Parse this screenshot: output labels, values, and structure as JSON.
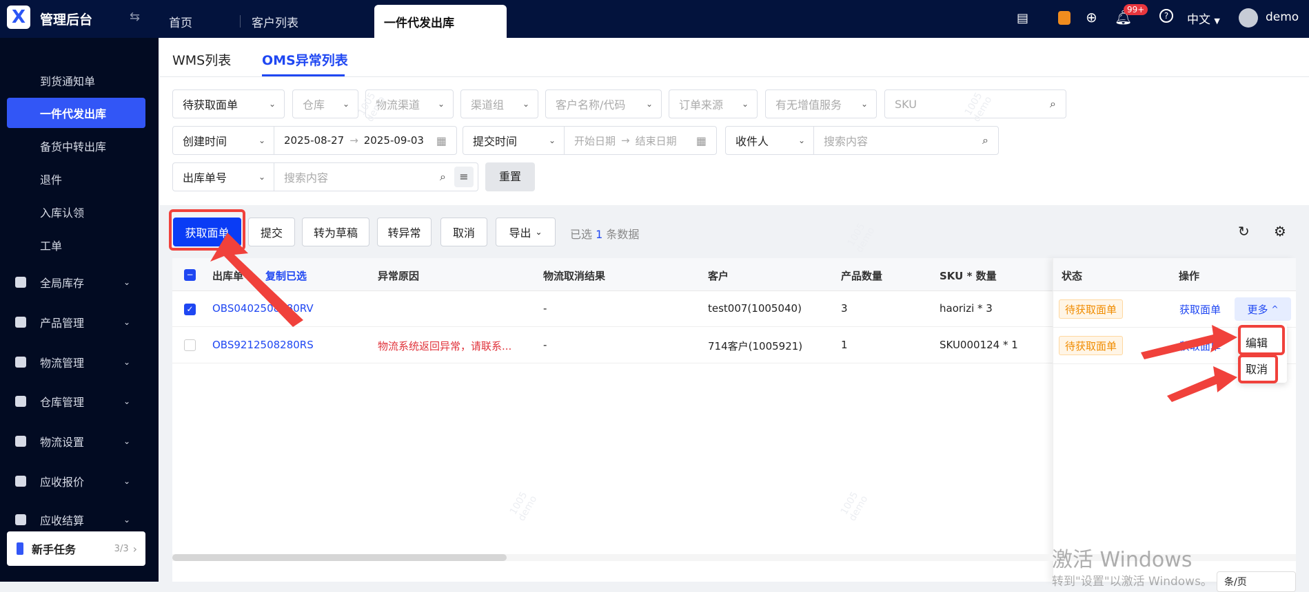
{
  "app": {
    "title": "管理后台"
  },
  "tabs": [
    {
      "label": "首页"
    },
    {
      "label": "客户列表"
    },
    {
      "label": "一件代发出库"
    }
  ],
  "header": {
    "notification_count": "99+",
    "language": "中文",
    "user": "demo"
  },
  "sidebar": {
    "items": [
      {
        "label": "到货通知单"
      },
      {
        "label": "一件代发出库",
        "active": true
      },
      {
        "label": "备货中转出库"
      },
      {
        "label": "退件"
      },
      {
        "label": "入库认领"
      },
      {
        "label": "工单"
      },
      {
        "label": "全局库存",
        "icon": "warehouse-icon"
      },
      {
        "label": "产品管理",
        "icon": "box-icon"
      },
      {
        "label": "物流管理",
        "icon": "truck-icon"
      },
      {
        "label": "仓库管理",
        "icon": "house-icon"
      },
      {
        "label": "物流设置",
        "icon": "logistics-icon"
      },
      {
        "label": "应收报价",
        "icon": "document-icon"
      },
      {
        "label": "应收结算",
        "icon": "settlement-icon"
      }
    ],
    "task_card": {
      "label": "新手任务",
      "progress": "3/3"
    }
  },
  "subtabs": [
    {
      "label": "WMS列表"
    },
    {
      "label": "OMS异常列表",
      "active": true
    }
  ],
  "filters": {
    "status": "待获取面单",
    "warehouse": "仓库",
    "channel": "物流渠道",
    "channel_group": "渠道组",
    "customer": "客户名称/代码",
    "order_source": "订单来源",
    "value_added": "有无增值服务",
    "sku": "SKU",
    "create_time_type": "创建时间",
    "create_start": "2025-08-27",
    "create_end": "2025-09-03",
    "submit_time_type": "提交时间",
    "submit_start": "开始日期",
    "submit_end": "结束日期",
    "receiver_type": "收件人",
    "receiver_placeholder": "搜索内容",
    "order_no_type": "出库单号",
    "order_no_placeholder": "搜索内容",
    "reset": "重置"
  },
  "toolbar": {
    "get_label": "获取面单",
    "submit": "提交",
    "to_draft": "转为草稿",
    "to_exception": "转异常",
    "cancel": "取消",
    "export": "导出",
    "selected_prefix": "已选",
    "selected_count": "1",
    "selected_suffix": "条数据"
  },
  "table": {
    "columns": [
      "出库单号",
      "复制已选",
      "异常原因",
      "物流取消结果",
      "客户",
      "产品数量",
      "SKU * 数量",
      "状态",
      "操作"
    ],
    "rows": [
      {
        "checked": true,
        "order_no": "OBS0402508280RV",
        "reason": "",
        "cancel_result": "-",
        "customer": "test007(1005040)",
        "qty": "3",
        "sku": "haorizi * 3",
        "status": "待获取面单",
        "action": "获取面单",
        "more": "更多"
      },
      {
        "checked": false,
        "order_no": "OBS9212508280RS",
        "reason": "物流系统返回异常，请联系...",
        "cancel_result": "-",
        "customer": "714客户(1005921)",
        "qty": "1",
        "sku": "SKU000124 * 1",
        "status": "待获取面单",
        "action": "获取面单"
      }
    ]
  },
  "more_menu": [
    "编辑",
    "取消"
  ],
  "pagination": {
    "page_size": "条/页"
  },
  "watermark": {
    "line1": "1005",
    "line2": "demo"
  },
  "os_notice": {
    "line1": "激活 Windows",
    "line2": "转到\"设置\"以激活 Windows。"
  },
  "colors": {
    "primary": "#1f47f2",
    "nav": "#03133d",
    "annotation": "#f0413b",
    "warning": "#f08c00",
    "error": "#e0323a"
  }
}
